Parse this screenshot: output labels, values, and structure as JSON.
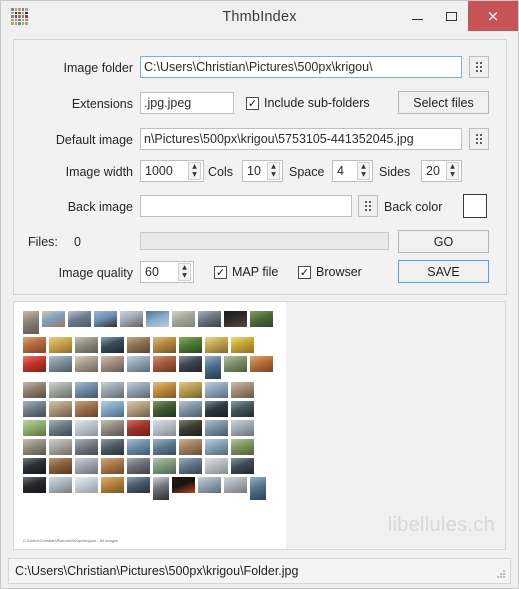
{
  "window": {
    "title": "ThmbIndex",
    "icon": "mosaic-grid-icon",
    "minimize_label": "",
    "maximize_label": "",
    "close_label": "×",
    "close_color": "#c75454"
  },
  "form": {
    "image_folder": {
      "label": "Image folder",
      "value": "C:\\Users\\Christian\\Pictures\\500px\\krigou\\",
      "placeholder": "",
      "browse_label": "browse-dots-icon"
    },
    "extensions": {
      "label": "Extensions",
      "value": ".jpg.jpeg",
      "placeholder": ""
    },
    "include_subfolders": {
      "label": "Include sub-folders",
      "checked": true,
      "check_glyph": "✓"
    },
    "select_files": {
      "label": "Select files"
    },
    "default_image": {
      "label": "Default image",
      "value": "n\\Pictures\\500px\\krigou\\5753105-441352045.jpg",
      "placeholder": "",
      "browse_label": "browse-dots-icon"
    },
    "image_width": {
      "label": "Image width",
      "value": "1000"
    },
    "cols": {
      "label": "Cols",
      "value": "10"
    },
    "space": {
      "label": "Space",
      "value": "4"
    },
    "sides": {
      "label": "Sides",
      "value": "20"
    },
    "back_image": {
      "label": "Back image",
      "value": "",
      "placeholder": "",
      "browse_label": "browse-dots-icon"
    },
    "back_color": {
      "label": "Back color",
      "value": "#ffffff"
    },
    "files": {
      "label": "Files:",
      "count": "0"
    },
    "progress": {
      "value": "0"
    },
    "go": {
      "label": "GO"
    },
    "image_quality": {
      "label": "Image quality",
      "value": "60"
    },
    "map_file": {
      "label": "MAP file",
      "checked": true,
      "check_glyph": "✓"
    },
    "browser": {
      "label": "Browser",
      "checked": true,
      "check_glyph": "✓"
    },
    "save": {
      "label": "SAVE",
      "focused": true,
      "focus_color": "#5a9fd4"
    },
    "spinner_up_glyph": "▲",
    "spinner_down_glyph": "▼"
  },
  "preview": {
    "caption": "C:\\Users\\Christian\\Pictures\\500px\\krigou\\ - 84 images",
    "watermark": "libellules.ch",
    "thumbnails": [
      {
        "o": "p",
        "c": [
          "#8a8272",
          "#5b5a50",
          "#c9b9a0"
        ]
      },
      {
        "o": "l",
        "c": [
          "#7ea0c2",
          "#9c7a5c",
          "#d8c8b0"
        ]
      },
      {
        "o": "l",
        "c": [
          "#6b7d8e",
          "#4a5a66",
          "#b9c3cc"
        ]
      },
      {
        "o": "l",
        "c": [
          "#6d8fb5",
          "#2d2f33",
          "#9fb7cd"
        ]
      },
      {
        "o": "l",
        "c": [
          "#9ba8b6",
          "#6d5f52",
          "#cdd6de"
        ]
      },
      {
        "o": "l",
        "c": [
          "#7fa8cc",
          "#c3ccd4",
          "#5e6f7d"
        ]
      },
      {
        "o": "l",
        "c": [
          "#a3a69a",
          "#7c8474",
          "#d2d4c8"
        ]
      },
      {
        "o": "l",
        "c": [
          "#6b7480",
          "#39404a",
          "#a9b2bb"
        ]
      },
      {
        "o": "l",
        "c": [
          "#2b2b2b",
          "#5b4a3c",
          "#1a1a1a"
        ]
      },
      {
        "o": "l",
        "c": [
          "#4c6b3a",
          "#2f4423",
          "#7fa05e"
        ]
      },
      {
        "o": "l",
        "c": [
          "#b5693e",
          "#7c4628",
          "#d9a377"
        ]
      },
      {
        "o": "l",
        "c": [
          "#c8a24a",
          "#8a6d2a",
          "#e6d08a"
        ]
      },
      {
        "o": "l",
        "c": [
          "#8e8c7e",
          "#5d5b50",
          "#c2c0b2"
        ]
      },
      {
        "o": "l",
        "c": [
          "#3a4a5c",
          "#1e2831",
          "#8fa2b4"
        ]
      },
      {
        "o": "l",
        "c": [
          "#8a7150",
          "#5a4631",
          "#c4ab86"
        ]
      },
      {
        "o": "l",
        "c": [
          "#b5873f",
          "#6f5323",
          "#e0bd7d"
        ]
      },
      {
        "o": "l",
        "c": [
          "#4d7a33",
          "#2d4a1d",
          "#86b061"
        ]
      },
      {
        "o": "l",
        "c": [
          "#c2a34d",
          "#7d6a2c",
          "#e8d896"
        ]
      },
      {
        "o": "l",
        "c": [
          "#c9a431",
          "#8a6f1e",
          "#f0dd7a"
        ]
      },
      {
        "o": "l",
        "c": [
          "#c2342a",
          "#7d1f19",
          "#e8756a"
        ]
      },
      {
        "o": "l",
        "c": [
          "#7d8e9c",
          "#4e5a64",
          "#b7c3cc"
        ]
      },
      {
        "o": "l",
        "c": [
          "#a79a8c",
          "#6e645a",
          "#d6ccbf"
        ]
      },
      {
        "o": "l",
        "c": [
          "#9e8d7f",
          "#655a50",
          "#cfc2b4"
        ]
      },
      {
        "o": "l",
        "c": [
          "#8fa3b4",
          "#5d6b77",
          "#c5d2db"
        ]
      },
      {
        "o": "l",
        "c": [
          "#a4593a",
          "#6b3524",
          "#d39072"
        ]
      },
      {
        "o": "l",
        "c": [
          "#3d4550",
          "#1f242b",
          "#8a919b"
        ]
      },
      {
        "o": "p",
        "c": [
          "#4a6b8e",
          "#273c52",
          "#9ab4cc"
        ]
      },
      {
        "o": "l",
        "c": [
          "#7c8e6a",
          "#4e5c42",
          "#b4c2a4"
        ]
      },
      {
        "o": "l",
        "c": [
          "#b4703a",
          "#744424",
          "#dda878"
        ]
      },
      {
        "o": "l",
        "c": [
          "#8e7e6c",
          "#5a4e42",
          "#c7baa9"
        ]
      },
      {
        "o": "l",
        "c": [
          "#9fa79b",
          "#676e64",
          "#cfd4cb"
        ]
      },
      {
        "o": "l",
        "c": [
          "#6f8aa8",
          "#41556a",
          "#a9bed1"
        ]
      },
      {
        "o": "l",
        "c": [
          "#98a2ac",
          "#616a73",
          "#c9d0d6"
        ]
      },
      {
        "o": "l",
        "c": [
          "#8fa0b0",
          "#5a6670",
          "#c4cdd5"
        ]
      },
      {
        "o": "l",
        "c": [
          "#c08a3c",
          "#7c5722",
          "#e4bb7d"
        ]
      },
      {
        "o": "l",
        "c": [
          "#b59a4e",
          "#756230",
          "#ddc78e"
        ]
      },
      {
        "o": "l",
        "c": [
          "#8ba3bb",
          "#566b7f",
          "#bfd0dd"
        ]
      },
      {
        "o": "l",
        "c": [
          "#a08a74",
          "#675748",
          "#cdbda9"
        ]
      },
      {
        "o": "l",
        "c": [
          "#6f7d8a",
          "#3f4b55",
          "#a9b5bf"
        ]
      },
      {
        "o": "l",
        "c": [
          "#a89478",
          "#6c5f4b",
          "#d3c5ab"
        ]
      },
      {
        "o": "l",
        "c": [
          "#9d6f49",
          "#63442c",
          "#caa37f"
        ]
      },
      {
        "o": "l",
        "c": [
          "#7fa4c4",
          "#4e6b86",
          "#b7d0e2"
        ]
      },
      {
        "o": "l",
        "c": [
          "#b09a7c",
          "#6f6050",
          "#d8c9ae"
        ]
      },
      {
        "o": "l",
        "c": [
          "#3f5b33",
          "#23351d",
          "#7d9c6b"
        ]
      },
      {
        "o": "l",
        "c": [
          "#7e93a6",
          "#4c5d6b",
          "#b6c5d1"
        ]
      },
      {
        "o": "l",
        "c": [
          "#2b3a45",
          "#151e25",
          "#7c8e9a"
        ]
      },
      {
        "o": "l",
        "c": [
          "#45565f",
          "#222c33",
          "#8b9ba3"
        ]
      },
      {
        "o": "l",
        "c": [
          "#8fae6f",
          "#5a7044",
          "#bdd4a3"
        ]
      },
      {
        "o": "l",
        "c": [
          "#6d7a84",
          "#3e4950",
          "#a7b2ba"
        ]
      },
      {
        "o": "l",
        "c": [
          "#b9c3cb",
          "#8e979f",
          "#e2e7eb"
        ]
      },
      {
        "o": "l",
        "c": [
          "#8d8a80",
          "#585550",
          "#c3c0b7"
        ]
      },
      {
        "o": "l",
        "c": [
          "#a2342a",
          "#661f19",
          "#cf6f63"
        ]
      },
      {
        "o": "l",
        "c": [
          "#b4bcc4",
          "#848c94",
          "#dde1e6"
        ]
      },
      {
        "o": "l",
        "c": [
          "#3b3d33",
          "#1d1f19",
          "#80836f"
        ]
      },
      {
        "o": "l",
        "c": [
          "#7b8f9e",
          "#4a5b67",
          "#b2c2cd"
        ]
      },
      {
        "o": "l",
        "c": [
          "#9fa9b2",
          "#6a737b",
          "#ccd2d8"
        ]
      },
      {
        "o": "l",
        "c": [
          "#8f8a7c",
          "#5a564c",
          "#c5c1b4"
        ]
      },
      {
        "o": "l",
        "c": [
          "#a5a59d",
          "#6e6e68",
          "#d0d0ca"
        ]
      },
      {
        "o": "l",
        "c": [
          "#727a82",
          "#434a50",
          "#abb2b8"
        ]
      },
      {
        "o": "l",
        "c": [
          "#4f5b66",
          "#2a323a",
          "#8f9aa4"
        ]
      },
      {
        "o": "l",
        "c": [
          "#6b8ca8",
          "#3f5868",
          "#a4c0d3"
        ]
      },
      {
        "o": "l",
        "c": [
          "#5e7b92",
          "#364a58",
          "#9cb6c7"
        ]
      },
      {
        "o": "l",
        "c": [
          "#a07e5c",
          "#654e38",
          "#cdb193"
        ]
      },
      {
        "o": "l",
        "c": [
          "#85a0b4",
          "#526574",
          "#bacfdd"
        ]
      },
      {
        "o": "l",
        "c": [
          "#7e9460",
          "#4e5c3a",
          "#b6c79a"
        ]
      },
      {
        "o": "l",
        "c": [
          "#2b2f33",
          "#141618",
          "#76797d"
        ]
      },
      {
        "o": "l",
        "c": [
          "#8a5f3d",
          "#553a24",
          "#bd9470"
        ]
      },
      {
        "o": "l",
        "c": [
          "#9fa6ae",
          "#696f76",
          "#ccd1d6"
        ]
      },
      {
        "o": "l",
        "c": [
          "#a9754a",
          "#6b482c",
          "#d4a87e"
        ]
      },
      {
        "o": "l",
        "c": [
          "#6c6f74",
          "#3e4044",
          "#a5a8ac"
        ]
      },
      {
        "o": "l",
        "c": [
          "#7d9a7c",
          "#4d614c",
          "#b3c8b2"
        ]
      },
      {
        "o": "l",
        "c": [
          "#5f7488",
          "#374453",
          "#9cafc0"
        ]
      },
      {
        "o": "l",
        "c": [
          "#b5bcc2",
          "#858c92",
          "#dee2e6"
        ]
      },
      {
        "o": "l",
        "c": [
          "#3f4a55",
          "#20262d",
          "#8694a0"
        ]
      },
      {
        "o": "l",
        "c": [
          "#26282b",
          "#121314",
          "#6e7176"
        ]
      },
      {
        "o": "l",
        "c": [
          "#aab4bd",
          "#767f87",
          "#d7dce1"
        ]
      },
      {
        "o": "l",
        "c": [
          "#c2cbd3",
          "#939ba3",
          "#e8ecef"
        ]
      },
      {
        "o": "l",
        "c": [
          "#b5823c",
          "#745022",
          "#e0ae77"
        ]
      },
      {
        "o": "l",
        "c": [
          "#4a5a6b",
          "#262f3a",
          "#8ea0b2"
        ]
      },
      {
        "o": "p",
        "c": [
          "#6e7276",
          "#2b2d2f",
          "#cfd2d4"
        ]
      },
      {
        "o": "l",
        "c": [
          "#141414",
          "#b5470f",
          "#2b1508"
        ]
      },
      {
        "o": "l",
        "c": [
          "#96a4b0",
          "#5f6c76",
          "#c6d0d8"
        ]
      },
      {
        "o": "l",
        "c": [
          "#a6aeb4",
          "#727a80",
          "#d2d8dc"
        ]
      },
      {
        "o": "p",
        "c": [
          "#55718c",
          "#2e4256",
          "#9ab2c6"
        ]
      }
    ]
  },
  "statusbar": {
    "path": "C:\\Users\\Christian\\Pictures\\500px\\krigou\\Folder.jpg"
  }
}
